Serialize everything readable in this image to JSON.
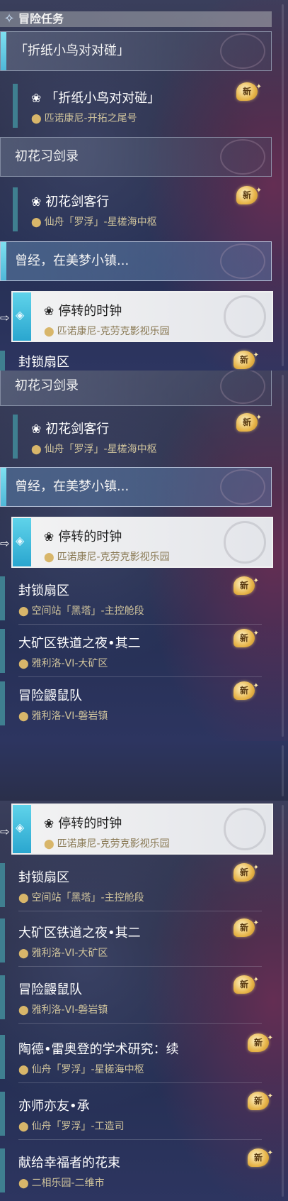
{
  "header": {
    "title": "冒险任务",
    "icon": "diamond-star-icon"
  },
  "categories": {
    "paper_bird": "「折纸小鸟对对碰」",
    "chuhua": "初花习剑录",
    "dream_town": "曾经，在美梦小镇..."
  },
  "quests": {
    "paper_bird": {
      "title": "「折纸小鸟对对碰」",
      "location": "匹诺康尼-开拓之尾号"
    },
    "sword_guest": {
      "title": "初花剑客行",
      "location": "仙舟「罗浮」-星槎海中枢"
    },
    "stopped_clock": {
      "title": "停转的时钟",
      "location": "匹诺康尼-克劳克影视乐园"
    },
    "lockdown": {
      "title": "封锁扇区",
      "location": "空间站「黑塔」-主控舱段"
    },
    "railway_night": {
      "title": "大矿区铁道之夜•其二",
      "location": "雅利洛-VI-大矿区"
    },
    "mole_team": {
      "title": "冒险鼹鼠队",
      "location": "雅利洛-VI-磐岩镇"
    },
    "tao_de": {
      "title": "陶德•雷奥登的学术研究：续",
      "location": "仙舟「罗浮」-星槎海中枢"
    },
    "mentor": {
      "title": "亦师亦友•承",
      "location": "仙舟「罗浮」-工造司"
    },
    "bouquet": {
      "title": "献给幸福者的花束",
      "location": "二相乐园-二维市"
    }
  },
  "badge_new": "新",
  "colors": {
    "accent": "#5fd3ea",
    "location": "#cfc39c",
    "badge": "#e7b54a"
  }
}
